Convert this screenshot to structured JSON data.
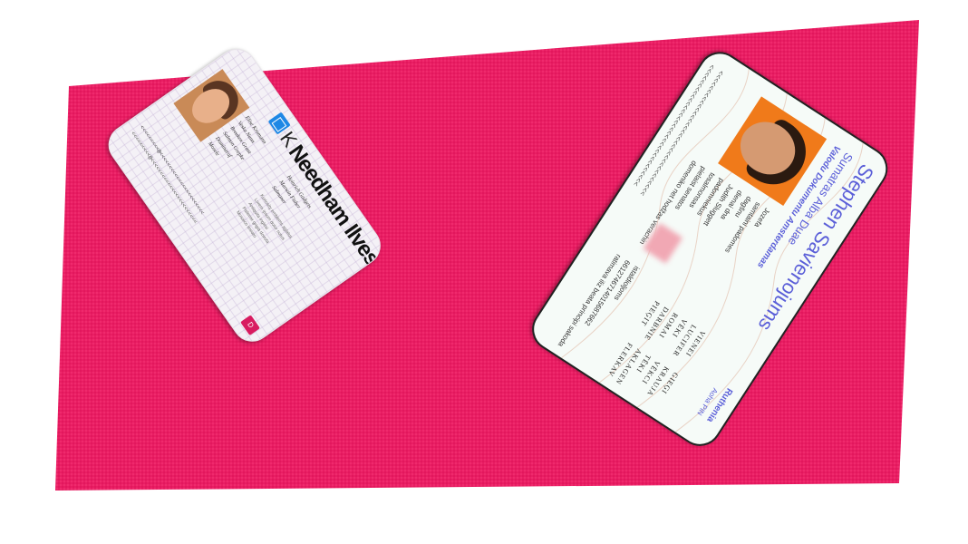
{
  "scene": {
    "background_color": "#e91e63",
    "page_color": "#ffffff"
  },
  "card1": {
    "name": "Needham Ilves",
    "logo_letter": "K",
    "logo_icon": "calendar-icon",
    "labels": [
      "Elise Kromann",
      "Veska Nunn",
      "Breuken Grant",
      "Salmon Grepke",
      "Dominaraf",
      "Mosele",
      "Heinrich Gadgets",
      "Marwin Fisher",
      "Salmaner"
    ],
    "values": [
      "Kuriosity emblems aglatus",
      "Lorem ipsum dolor notus",
      "Antiquita inglesi",
      "Pallente grigia dovuta",
      "Mosaico lineato"
    ],
    "mrz_lines": [
      "<<<<<<<<<@<<<<<<<<<<<<<<<<<<<<<<<",
      "<<<<<<<<<@<<<<<<<<<<<<<<<<<<<<<<<<"
    ],
    "badge_text": "D"
  },
  "card2": {
    "holder_name": "Stephen Savienojums",
    "line1": "Sumatras Alba Duae",
    "line2": "Valodu Dokumentu Amsterdamas",
    "country": "Ruthenia",
    "country_sub": "Aoha PIN",
    "fields": [
      "Jozefa",
      "samtaini padomes",
      "dagšnu",
      "dienai dna",
      "Judith Sluggett",
      "padomniekus",
      "tosalmonsas",
      "pielaist senatos",
      "domeniko net hodžas verachin",
      "istaldioljoms",
      "6612746714015687662",
      "ratimava iliz beata principi sakoda"
    ],
    "keys": [
      "VIENEI",
      "LUCIFER",
      "VĒKI",
      "ROMAI",
      "DARBNIE",
      "PIEĢIT",
      "GIEĢI",
      "KRAUJA",
      "VĒKCI",
      "TĒKI",
      "AKLAGEN",
      "FLERKAV"
    ],
    "mrz_lines": [
      "<<<<<<<<<<<<<<<<<<<<<<<<<<<<<<<<<<",
      "<<<<<<<<<<<<<<<<<<<<<<<<<<<<<<<<<"
    ]
  }
}
